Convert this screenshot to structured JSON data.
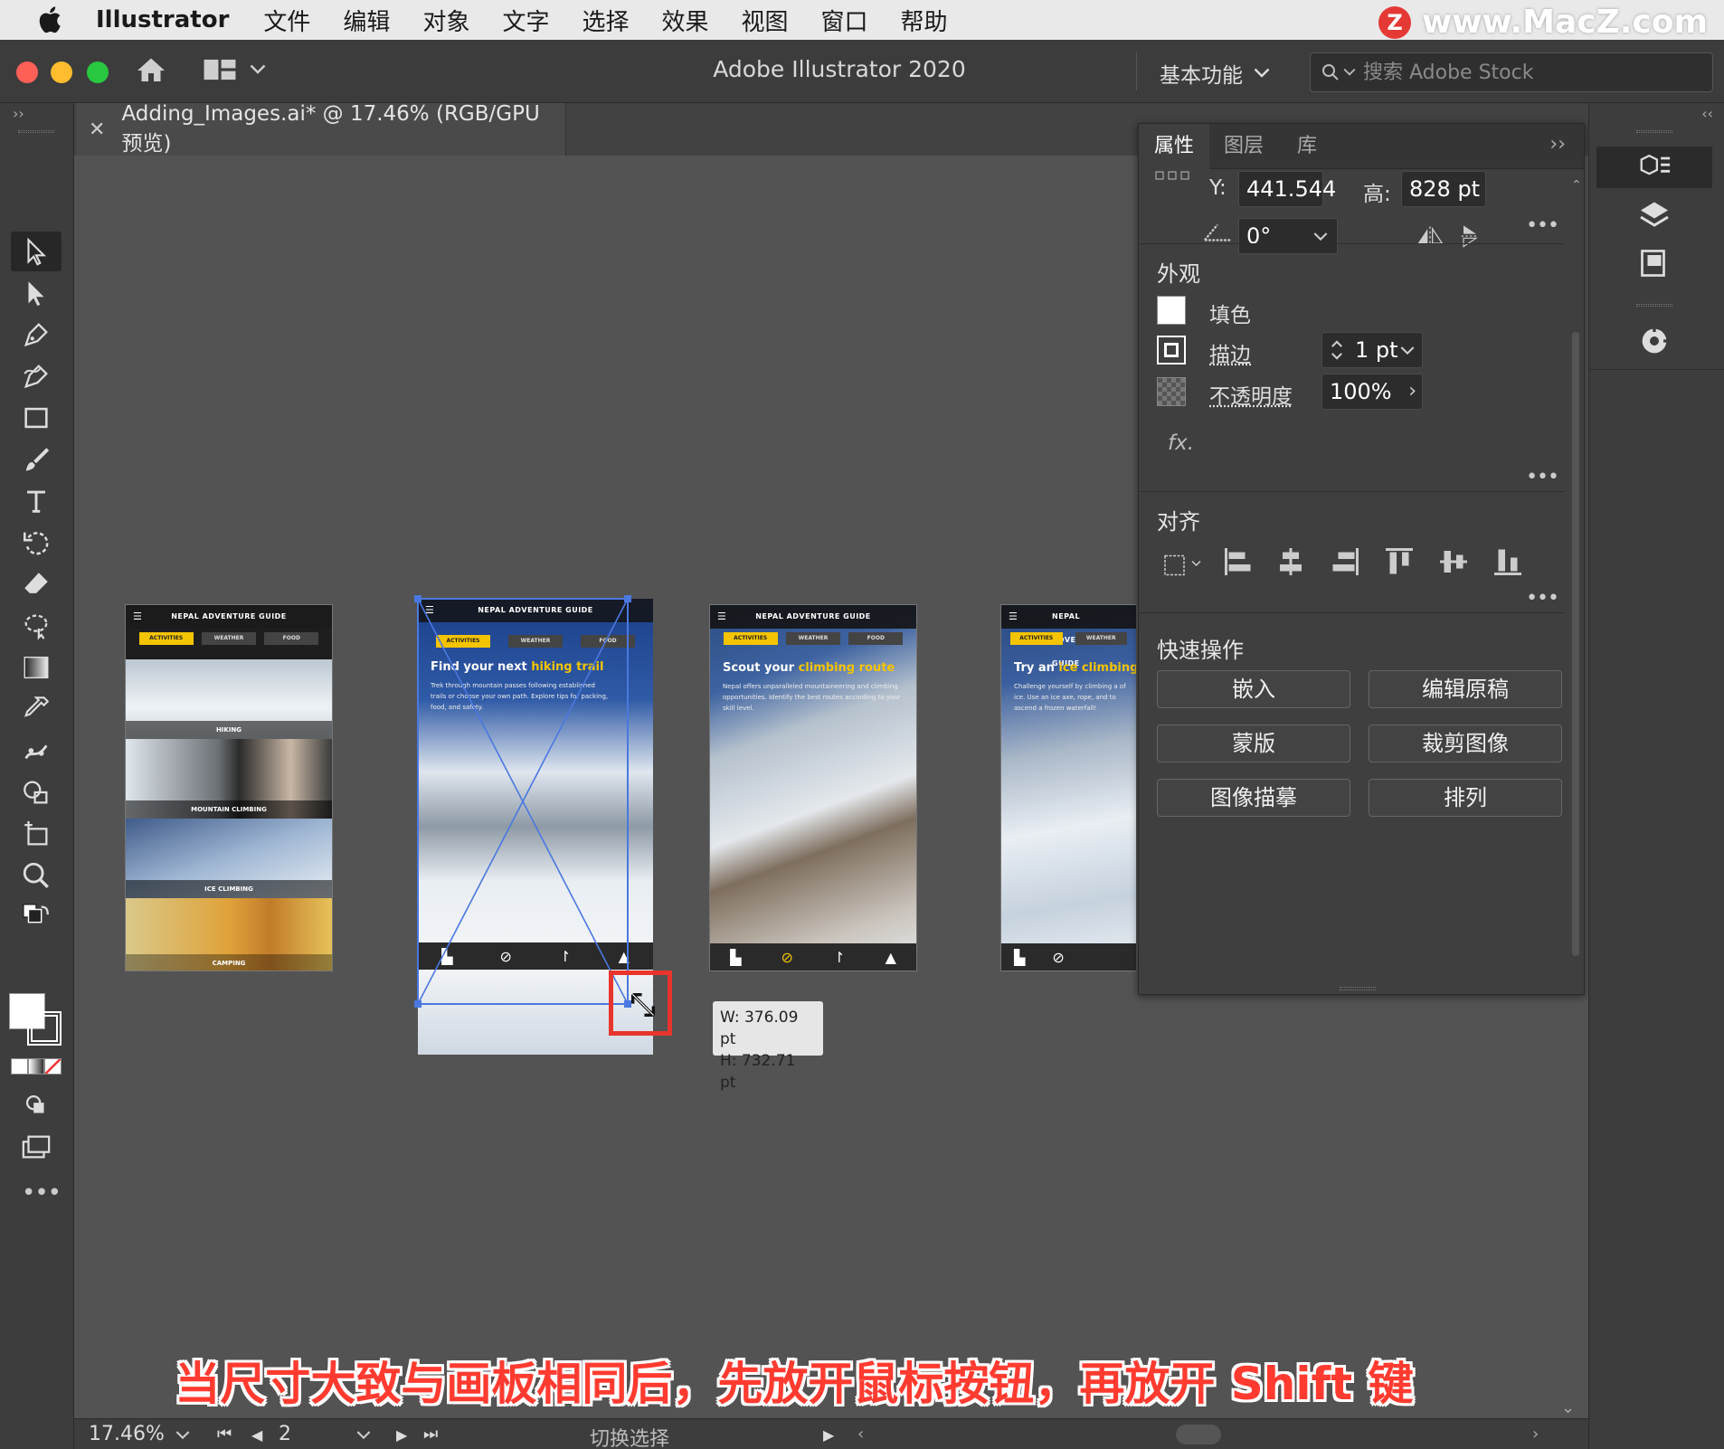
{
  "menubar": {
    "app_name": "Illustrator",
    "items": [
      "文件",
      "编辑",
      "对象",
      "文字",
      "选择",
      "效果",
      "视图",
      "窗口",
      "帮助"
    ]
  },
  "watermark": {
    "logo_letter": "Z",
    "text": "www.MacZ.com"
  },
  "window": {
    "title": "Adobe Illustrator 2020",
    "workspace_label": "基本功能",
    "search_placeholder": "搜索 Adobe Stock"
  },
  "document_tab": {
    "label": "Adding_Images.ai* @ 17.46% (RGB/GPU 预览)"
  },
  "artboards": [
    {
      "header": "NEPAL ADVENTURE GUIDE",
      "tabs": [
        "ACTIVITIES",
        "WEATHER",
        "FOOD"
      ],
      "strips": [
        "HIKING",
        "MOUNTAIN CLIMBING",
        "ICE CLIMBING",
        "CAMPING"
      ]
    },
    {
      "header": "NEPAL ADVENTURE GUIDE",
      "tabs": [
        "ACTIVITIES",
        "WEATHER",
        "FOOD"
      ],
      "headline_pre": "Find your next ",
      "headline_hl": "hiking trail",
      "body": "Trek through mountain passes following established trails or choose your own path. Explore tips for packing, food, and safety."
    },
    {
      "header": "NEPAL ADVENTURE GUIDE",
      "tabs": [
        "ACTIVITIES",
        "WEATHER",
        "FOOD"
      ],
      "headline_pre": "Scout your ",
      "headline_hl": "climbing route",
      "body": "Nepal offers unparalleled mountaineering and climbing opportunities. Identify the best routes according to your skill level."
    },
    {
      "header": "NEPAL ADVENTURE GUIDE",
      "tabs": [
        "ACTIVITIES",
        "WEATHER"
      ],
      "headline_pre": "Try an ",
      "headline_hl": "ice climbing ex",
      "body": "Challenge yourself by climbing a of ice. Use an ice axe, rope, and to ascend a frozen waterfall!"
    }
  ],
  "tooltip": {
    "width": "W: 376.09 pt",
    "height": "H: 732.71 pt"
  },
  "caption": "当尺寸大致与画板相同后，先放开鼠标按钮，再放开 Shift 键",
  "statusbar": {
    "zoom": "17.46%",
    "page": "2",
    "mode": "切换选择"
  },
  "properties_panel": {
    "tabs": [
      "属性",
      "图层",
      "库"
    ],
    "transform": {
      "y_label": "Y:",
      "y_value": "441.544",
      "h_label": "高:",
      "h_value": "828 pt",
      "angle_value": "0°"
    },
    "appearance": {
      "title": "外观",
      "fill_label": "填色",
      "stroke_label": "描边",
      "stroke_value": "1 pt",
      "opacity_label": "不透明度",
      "opacity_value": "100%",
      "fx_label": "fx."
    },
    "align": {
      "title": "对齐"
    },
    "quick_actions": {
      "title": "快速操作",
      "buttons": [
        "嵌入",
        "编辑原稿",
        "蒙版",
        "裁剪图像",
        "图像描摹",
        "排列"
      ]
    }
  },
  "colors": {
    "accent_selection": "#4a78e0",
    "highlight_red": "#e8352c",
    "artboard_yellow": "#f4c400"
  }
}
